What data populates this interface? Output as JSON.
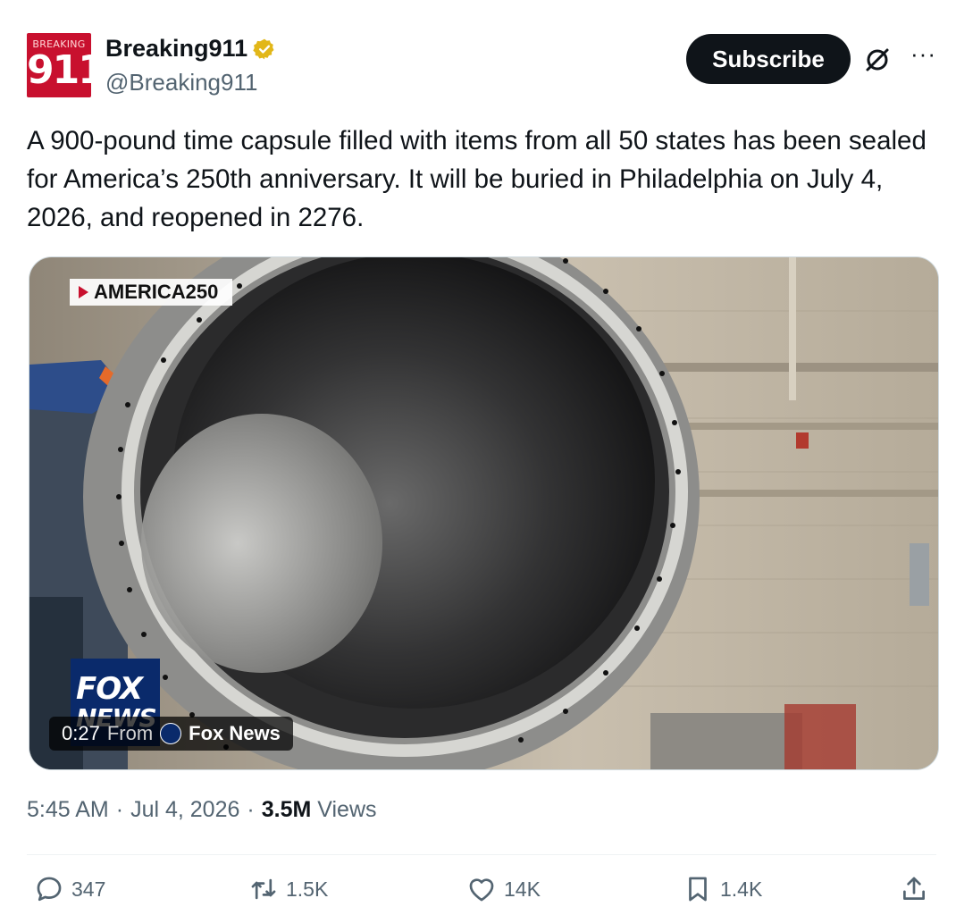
{
  "author": {
    "display_name": "Breaking911",
    "handle": "@Breaking911",
    "avatar_small_text": "BREAKING",
    "avatar_big_text": "911",
    "avatar_color": "#c8102e"
  },
  "actions_top": {
    "subscribe_label": "Subscribe",
    "grok_icon": "grok-icon",
    "more_label": "···"
  },
  "tweet": {
    "text": "A 900-pound time capsule filled with items from all 50 states has been sealed for America’s 250th anniversary. It will be buried in Philadelphia on July 4, 2026, and reopened in 2276."
  },
  "video": {
    "program_tag": "AMERICA250",
    "logo_line1": "FOX",
    "logo_line2": "NEWS",
    "duration": "0:27",
    "from_label": "From",
    "source": "Fox News"
  },
  "meta": {
    "time": "5:45 AM",
    "sep1": "·",
    "date": "Jul 4, 2026",
    "sep2": "·",
    "views_count": "3.5M",
    "views_label": "Views"
  },
  "engagement": {
    "replies": "347",
    "reposts": "1.5K",
    "likes": "14K",
    "bookmarks": "1.4K"
  },
  "colors": {
    "text": "#0f1419",
    "muted": "#536471",
    "verified": "#e2b719",
    "button_bg": "#0f1419"
  }
}
